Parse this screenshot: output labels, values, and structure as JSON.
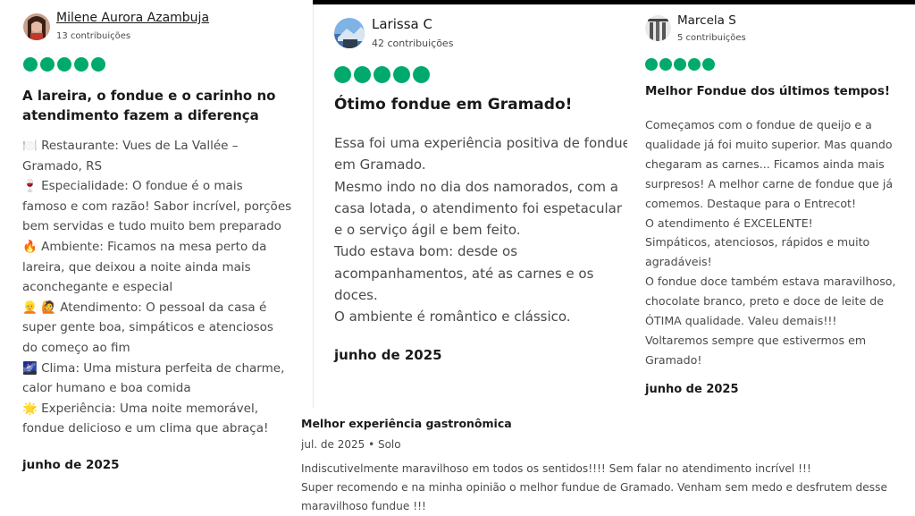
{
  "review1": {
    "user": "Milene Aurora Azambuja",
    "contributions": "13 contribuições",
    "rating": 5,
    "title_lines": [
      "A lareira, o fondue e o carinho no",
      "atendimento fazem a diferença"
    ],
    "body_lines": [
      "🍽️ Restaurante: Vues de La Vallée –",
      "Gramado, RS",
      "🍷 Especialidade: O fondue é o mais",
      "famoso e com razão! Sabor incrível, porções",
      "bem servidas e tudo muito bem preparado",
      "🔥 Ambiente: Ficamos na mesa perto da",
      "lareira, que deixou a noite ainda mais",
      "aconchegante e especial",
      "👱 🙋 Atendimento: O pessoal da casa é",
      "super gente boa, simpáticos e atenciosos",
      "do começo ao fim",
      "🌌 Clima: Uma mistura perfeita de charme,",
      "calor humano e boa comida",
      "🌟 Experiência: Uma noite memorável,",
      "fondue delicioso e um clima que abraça!"
    ],
    "date": "junho de 2025"
  },
  "review2": {
    "user": "Larissa C",
    "contributions": "42 contribuições",
    "rating": 5,
    "title": "Ótimo fondue em Gramado!",
    "body_lines": [
      "Essa foi uma experiência positiva de fondue",
      "em Gramado.",
      "Mesmo indo no dia dos namorados, com a",
      "casa lotada, o atendimento foi espetacular",
      "e o serviço ágil e bem feito.",
      "Tudo estava bom: desde os",
      "acompanhamentos, até as carnes e os",
      "doces.",
      "O ambiente é romântico e clássico."
    ],
    "date": "junho de 2025"
  },
  "review3": {
    "user": "Marcela S",
    "contributions": "5 contribuições",
    "rating": 5,
    "title": "Melhor Fondue dos últimos tempos!",
    "body_lines": [
      "Começamos com o fondue de queijo e a",
      "qualidade já foi muito superior. Mas quando",
      "chegaram as carnes... Ficamos ainda mais",
      "surpresos! A melhor carne de fondue que já",
      "comemos. Destaque para o Entrecot!",
      "O atendimento é EXCELENTE!",
      "Simpáticos, atenciosos, rápidos e muito",
      "agradáveis!",
      "O fondue doce também estava maravilhoso,",
      "chocolate branco, preto e doce de leite de",
      "ÓTIMA qualidade. Valeu demais!!!",
      "Voltaremos sempre que estivermos em",
      "Gramado!"
    ],
    "date": "junho de 2025"
  },
  "review4": {
    "title": "Melhor experiência gastronômica",
    "meta": "jul. de 2025 • Solo",
    "body_lines": [
      "Indiscutivelmente maravilhoso em todos os sentidos!!!! Sem falar no atendimento incrível !!!",
      "Super recomendo e na minha opinião o melhor fundue de Gramado. Venham sem medo e desfrutem desse",
      "maravilhoso fundue !!!"
    ]
  },
  "colors": {
    "rating_green": "#00aa6c",
    "text": "#4a4a4a",
    "heading": "#1a1a1a"
  }
}
